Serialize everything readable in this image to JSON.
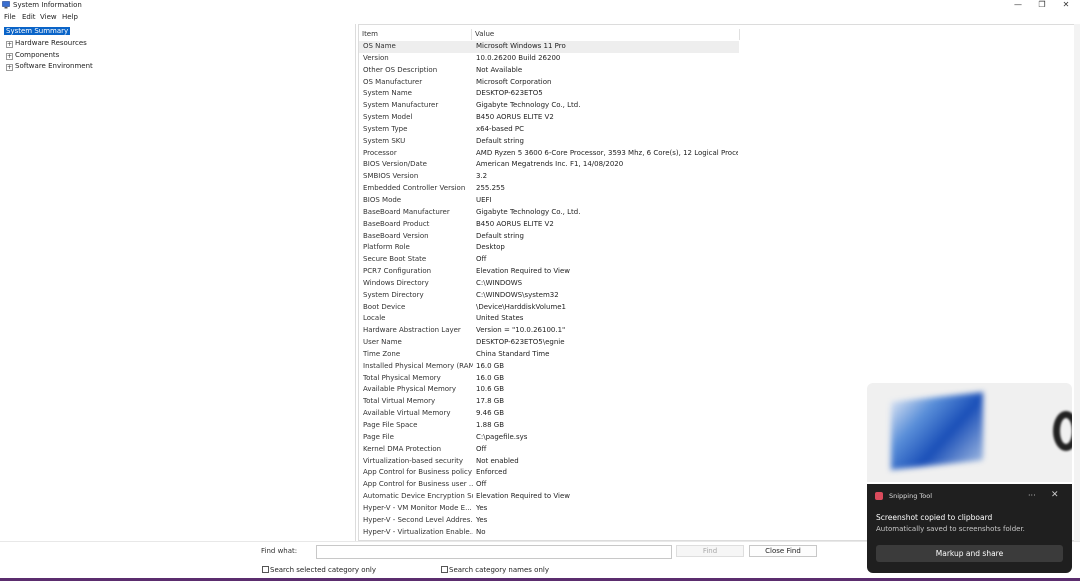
{
  "window": {
    "title": "System Information",
    "minimize_glyph": "—",
    "restore_glyph": "❐",
    "close_glyph": "✕",
    "icon": "system-info-icon"
  },
  "menu": [
    "File",
    "Edit",
    "View",
    "Help"
  ],
  "tree": [
    {
      "label": "System Summary",
      "selected": true,
      "expander": ""
    },
    {
      "label": "Hardware Resources",
      "selected": false,
      "expander": "+"
    },
    {
      "label": "Components",
      "selected": false,
      "expander": "+"
    },
    {
      "label": "Software Environment",
      "selected": false,
      "expander": "+"
    }
  ],
  "table": {
    "columns": [
      "Item",
      "Value"
    ],
    "rows": [
      [
        "OS Name",
        "Microsoft Windows 11 Pro"
      ],
      [
        "Version",
        "10.0.26200 Build 26200"
      ],
      [
        "Other OS Description",
        "Not Available"
      ],
      [
        "OS Manufacturer",
        "Microsoft Corporation"
      ],
      [
        "System Name",
        "DESKTOP-623ETO5"
      ],
      [
        "System Manufacturer",
        "Gigabyte Technology Co., Ltd."
      ],
      [
        "System Model",
        "B450 AORUS ELITE V2"
      ],
      [
        "System Type",
        "x64-based PC"
      ],
      [
        "System SKU",
        "Default string"
      ],
      [
        "Processor",
        "AMD Ryzen 5 3600 6-Core Processor, 3593 Mhz, 6 Core(s), 12 Logical Proces..."
      ],
      [
        "BIOS Version/Date",
        "American Megatrends Inc. F1, 14/08/2020"
      ],
      [
        "SMBIOS Version",
        "3.2"
      ],
      [
        "Embedded Controller Version",
        "255.255"
      ],
      [
        "BIOS Mode",
        "UEFI"
      ],
      [
        "BaseBoard Manufacturer",
        "Gigabyte Technology Co., Ltd."
      ],
      [
        "BaseBoard Product",
        "B450 AORUS ELITE V2"
      ],
      [
        "BaseBoard Version",
        "Default string"
      ],
      [
        "Platform Role",
        "Desktop"
      ],
      [
        "Secure Boot State",
        "Off"
      ],
      [
        "PCR7 Configuration",
        "Elevation Required to View"
      ],
      [
        "Windows Directory",
        "C:\\WINDOWS"
      ],
      [
        "System Directory",
        "C:\\WINDOWS\\system32"
      ],
      [
        "Boot Device",
        "\\Device\\HarddiskVolume1"
      ],
      [
        "Locale",
        "United States"
      ],
      [
        "Hardware Abstraction Layer",
        "Version = \"10.0.26100.1\""
      ],
      [
        "User Name",
        "DESKTOP-623ETO5\\egnie"
      ],
      [
        "Time Zone",
        "China Standard Time"
      ],
      [
        "Installed Physical Memory (RAM)",
        "16.0 GB"
      ],
      [
        "Total Physical Memory",
        "16.0 GB"
      ],
      [
        "Available Physical Memory",
        "10.6 GB"
      ],
      [
        "Total Virtual Memory",
        "17.8 GB"
      ],
      [
        "Available Virtual Memory",
        "9.46 GB"
      ],
      [
        "Page File Space",
        "1.88 GB"
      ],
      [
        "Page File",
        "C:\\pagefile.sys"
      ],
      [
        "Kernel DMA Protection",
        "Off"
      ],
      [
        "Virtualization-based security",
        "Not enabled"
      ],
      [
        "App Control for Business policy",
        "Enforced"
      ],
      [
        "App Control for Business user ...",
        "Off"
      ],
      [
        "Automatic Device Encryption Su...",
        "Elevation Required to View"
      ],
      [
        "Hyper-V - VM Monitor Mode E...",
        "Yes"
      ],
      [
        "Hyper-V - Second Level Addres...",
        "Yes"
      ],
      [
        "Hyper-V - Virtualization Enable...",
        "No"
      ]
    ]
  },
  "find": {
    "label": "Find what:",
    "value": "",
    "find_button": "Find",
    "close_button": "Close Find",
    "checkbox_selected": "Search selected category only",
    "checkbox_names": "Search category names only"
  },
  "toast": {
    "app_name": "Snipping Tool",
    "more_glyph": "···",
    "close_glyph": "✕",
    "title": "Screenshot copied to clipboard",
    "subtitle": "Automatically saved to screenshots folder.",
    "action": "Markup and share"
  },
  "colors": {
    "selection": "#0a64c8",
    "toast_bg": "#1f1f1f",
    "toast_button": "#3b3b3b"
  }
}
